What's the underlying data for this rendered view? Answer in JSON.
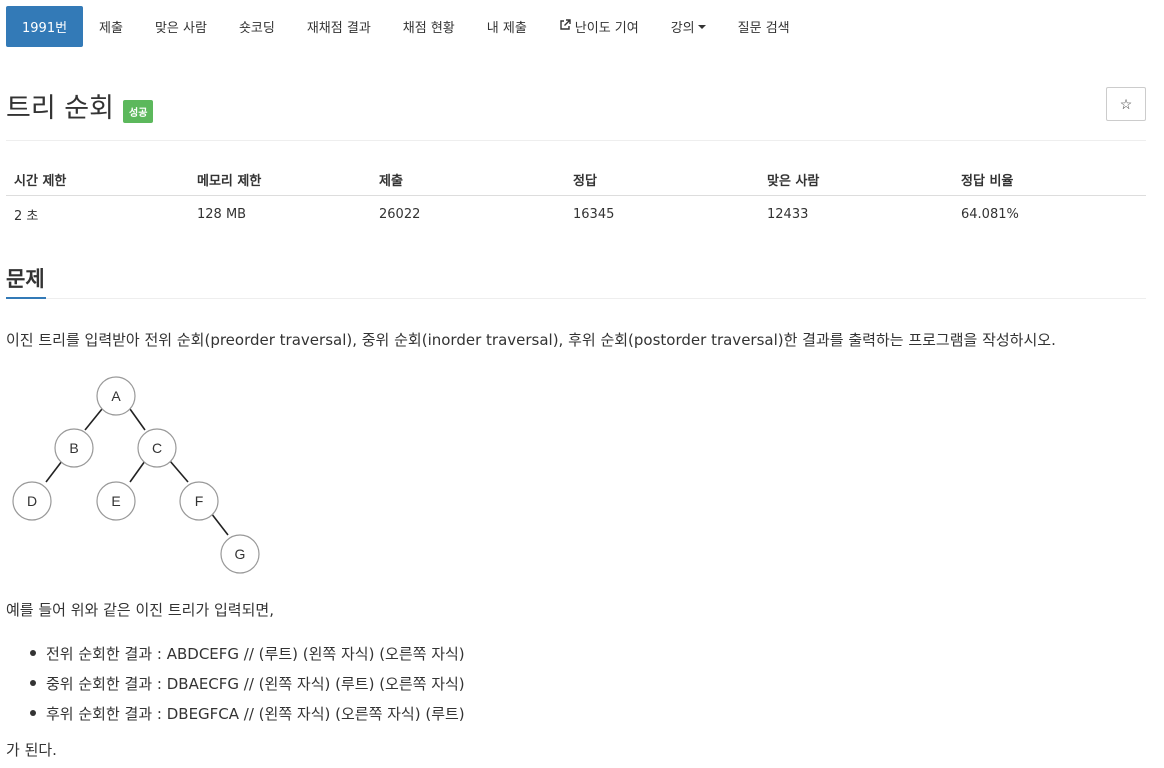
{
  "nav": {
    "problem_id": "1991번",
    "submit": "제출",
    "solved": "맞은 사람",
    "shortcoding": "숏코딩",
    "rejudge": "재채점 결과",
    "status": "채점 현황",
    "my_submit": "내 제출",
    "difficulty": "난이도 기여",
    "lecture": "강의",
    "qna": "질문 검색"
  },
  "problem": {
    "title": "트리 순회",
    "badge": "성공",
    "star": "☆"
  },
  "info": {
    "headers": [
      "시간 제한",
      "메모리 제한",
      "제출",
      "정답",
      "맞은 사람",
      "정답 비율"
    ],
    "values": [
      "2 초",
      "128 MB",
      "26022",
      "16345",
      "12433",
      "64.081%"
    ]
  },
  "section": {
    "title": "문제",
    "description": "이진 트리를 입력받아 전위 순회(preorder traversal), 중위 순회(inorder traversal), 후위 순회(postorder traversal)한 결과를 출력하는 프로그램을 작성하시오.",
    "example_intro": "예를 들어 위와 같은 이진 트리가 입력되면,",
    "results": [
      "전위 순회한 결과 : ABDCEFG // (루트) (왼쪽 자식) (오른쪽 자식)",
      "중위 순회한 결과 : DBAECFG // (왼쪽 자식) (루트) (오른쪽 자식)",
      "후위 순회한 결과 : DBEGFCA // (왼쪽 자식) (오른쪽 자식) (루트)"
    ],
    "closing": "가 된다."
  },
  "tree": {
    "nodes": [
      "A",
      "B",
      "C",
      "D",
      "E",
      "F",
      "G"
    ]
  }
}
